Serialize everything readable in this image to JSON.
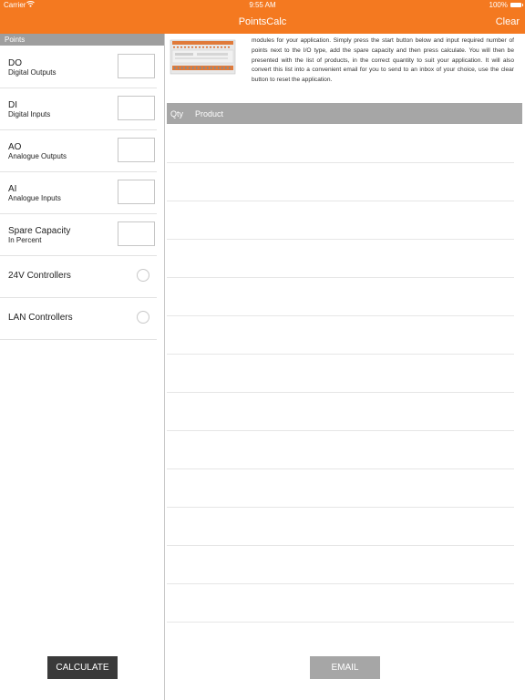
{
  "status_bar": {
    "carrier": "Carrier",
    "time": "9:55 AM",
    "battery": "100%"
  },
  "nav": {
    "title": "PointsCalc",
    "clear_label": "Clear"
  },
  "points": {
    "header": "Points",
    "inputs": [
      {
        "label": "DO",
        "sublabel": "Digital Outputs",
        "value": ""
      },
      {
        "label": "DI",
        "sublabel": "Digital Inputs",
        "value": ""
      },
      {
        "label": "AO",
        "sublabel": "Analogue Outputs",
        "value": ""
      },
      {
        "label": "AI",
        "sublabel": "Analogue Inputs",
        "value": ""
      },
      {
        "label": "Spare Capacity",
        "sublabel": "In Percent",
        "value": ""
      }
    ],
    "options": [
      {
        "label": "24V Controllers",
        "selected": false
      },
      {
        "label": "LAN Controllers",
        "selected": false
      }
    ],
    "calculate_label": "CALCULATE"
  },
  "main": {
    "intro_text": "modules for your application. Simply press the start button below and input required number of points next to the I/O type, add the spare capacity and then press calculate. You will then be presented with the list of products, in the correct quantity to suit your application. It will also convert this list into a convenient email for you to send to an inbox of your choice, use the clear button to reset the application.",
    "table_headers": {
      "qty": "Qty",
      "product": "Product"
    },
    "email_label": "EMAIL"
  },
  "colors": {
    "accent": "#f47920",
    "header_gray": "#9e9e9e",
    "table_header_gray": "#a6a6a6",
    "calculate_bg": "#3a3a3a"
  }
}
